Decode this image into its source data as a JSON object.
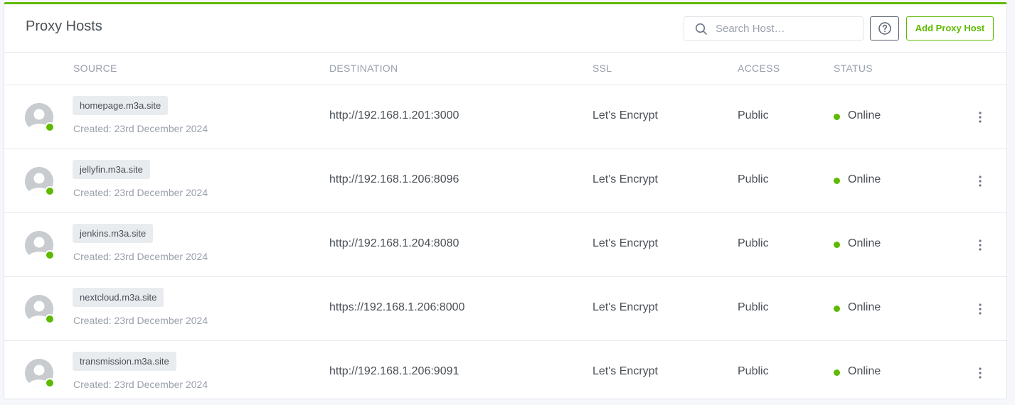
{
  "header": {
    "title": "Proxy Hosts",
    "search_placeholder": "Search Host…",
    "add_button_label": "Add Proxy Host"
  },
  "icons": {
    "search": "search-icon",
    "help": "help-circle-icon",
    "avatar": "user-avatar-icon",
    "menu": "more-vertical-icon"
  },
  "colors": {
    "accent": "#5eba00",
    "online": "#5eba00"
  },
  "columns": {
    "source": "SOURCE",
    "destination": "DESTINATION",
    "ssl": "SSL",
    "access": "ACCESS",
    "status": "STATUS"
  },
  "rows": [
    {
      "domain": "homepage.m3a.site",
      "created": "Created: 23rd December 2024",
      "destination": "http://192.168.1.201:3000",
      "ssl": "Let's Encrypt",
      "access": "Public",
      "status": "Online"
    },
    {
      "domain": "jellyfin.m3a.site",
      "created": "Created: 23rd December 2024",
      "destination": "http://192.168.1.206:8096",
      "ssl": "Let's Encrypt",
      "access": "Public",
      "status": "Online"
    },
    {
      "domain": "jenkins.m3a.site",
      "created": "Created: 23rd December 2024",
      "destination": "http://192.168.1.204:8080",
      "ssl": "Let's Encrypt",
      "access": "Public",
      "status": "Online"
    },
    {
      "domain": "nextcloud.m3a.site",
      "created": "Created: 23rd December 2024",
      "destination": "https://192.168.1.206:8000",
      "ssl": "Let's Encrypt",
      "access": "Public",
      "status": "Online"
    },
    {
      "domain": "transmission.m3a.site",
      "created": "Created: 23rd December 2024",
      "destination": "http://192.168.1.206:9091",
      "ssl": "Let's Encrypt",
      "access": "Public",
      "status": "Online"
    }
  ]
}
